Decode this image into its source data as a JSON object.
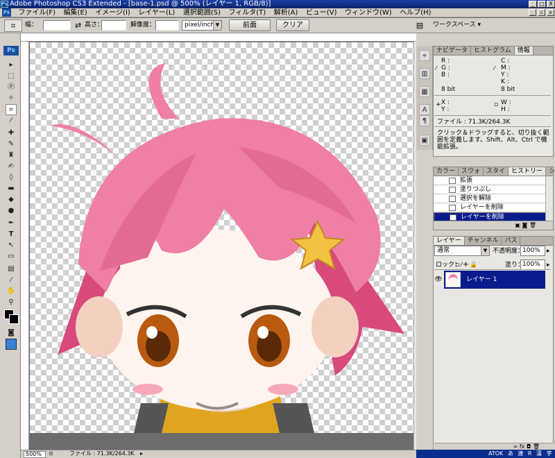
{
  "window": {
    "title": "Adobe Photoshop CS3 Extended - [base-1.psd @ 500% (レイヤー 1, RGB/8)]",
    "app_badge": "Ps",
    "min_label": "_",
    "max_label": "□",
    "close_label": "X"
  },
  "menu": {
    "items": [
      "ファイル(F)",
      "編集(E)",
      "イメージ(I)",
      "レイヤー(L)",
      "選択範囲(S)",
      "フィルタ(T)",
      "解析(A)",
      "ビュー(V)",
      "ウィンドウ(W)",
      "ヘルプ(H)"
    ]
  },
  "options": {
    "tool_icon": "crop-icon",
    "width_label": "幅：",
    "swap_label": "⇄",
    "height_label": "高さ：",
    "resolution_label": "解像度：",
    "unit_value": "pixel/inch",
    "front_button": "前面",
    "clear_button": "クリア",
    "workspace_label": "ワークスペース ▾"
  },
  "tools": [
    "▭",
    "⬚",
    "ⓟ",
    "✧",
    "⌗",
    "✎",
    "⁄",
    "✦",
    "♦",
    "◉",
    "⊡",
    "◐",
    "✏",
    "T",
    "▸",
    "□",
    "✋",
    "🔍"
  ],
  "panel_info": {
    "tabs": [
      "ナビゲータ",
      "ヒストグラム",
      "情報"
    ],
    "r_label": "R :",
    "g_label": "G :",
    "b_label": "B :",
    "c_label": "C :",
    "m_label": "M :",
    "y_label": "Y :",
    "k_label": "K :",
    "bit_left": "8 bit",
    "bit_right": "8 bit",
    "x_label": "X :",
    "y2_label": "Y :",
    "w_label": "W :",
    "h_label": "H :",
    "file_info": "ファイル : 71.3K/264.3K",
    "hint": "クリック＆ドラッグすると、切り抜く範囲を定義します。Shift、Alt、Ctrl で機能拡張。"
  },
  "panel_history": {
    "tabs": [
      "カラー",
      "スウォ",
      "スタイ",
      "ヒストリー",
      "ション"
    ],
    "rows": [
      "拡張",
      "塗りつぶし",
      "選択を解除",
      "レイヤーを削除",
      "レイヤーを削除"
    ]
  },
  "panel_layers": {
    "tabs": [
      "レイヤー",
      "チャンネル",
      "パス"
    ],
    "blend_mode": "通常",
    "opacity_label": "不透明度：",
    "opacity_value": "100%",
    "lock_label": "ロック：",
    "fill_label": "塗り：",
    "fill_value": "100%",
    "layer_name": "レイヤー 1"
  },
  "status": {
    "zoom": "500%",
    "file_info": "ファイル : 71.3K/264.3K"
  },
  "taskbar": {
    "items": [
      "ATOK",
      "あ",
      "連",
      "R",
      "漢",
      "字"
    ]
  }
}
